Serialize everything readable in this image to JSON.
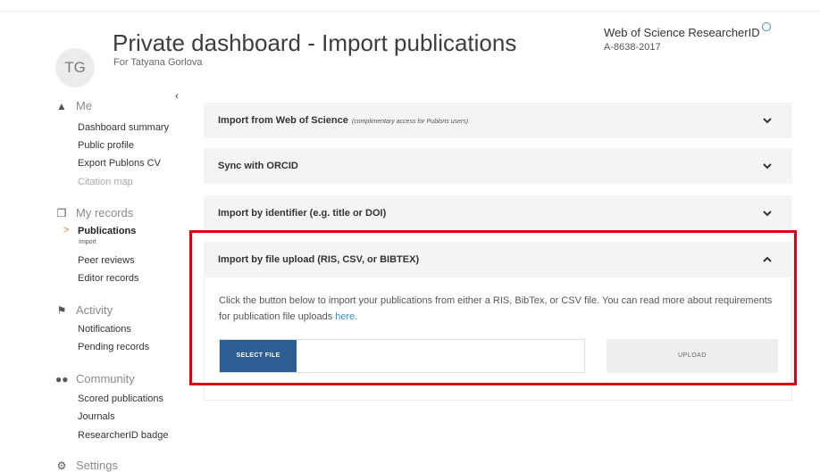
{
  "header": {
    "avatar_initials": "TG",
    "title": "Private dashboard - Import publications",
    "subtitle": "For Tatyana Gorlova",
    "researcher_id_label": "Web of Science ResearcherID",
    "researcher_id_value": "A-8638-2017"
  },
  "sidebar": {
    "collapse_glyph": "‹",
    "sections": {
      "me": {
        "label": "Me",
        "icon": "person-icon"
      },
      "records": {
        "label": "My records",
        "icon": "records-icon"
      },
      "activity": {
        "label": "Activity",
        "icon": "flag-icon"
      },
      "community": {
        "label": "Community",
        "icon": "group-icon"
      },
      "settings": {
        "label": "Settings",
        "icon": "gear-icon"
      }
    },
    "me_items": [
      "Dashboard summary",
      "Public profile",
      "Export Publons CV",
      "Citation map"
    ],
    "records_items": [
      "Publications",
      "Import",
      "Peer reviews",
      "Editor records"
    ],
    "activity_items": [
      "Notifications",
      "Pending records"
    ],
    "community_items": [
      "Scored publications",
      "Journals",
      "ResearcherID badge"
    ]
  },
  "panels": {
    "wos_label": "Import from Web of Science",
    "wos_note": "(complimentary access for Publons users)",
    "orcid_label": "Sync with ORCID",
    "identifier_label": "Import by identifier (e.g. title or DOI)",
    "file_label": "Import by file upload (RIS, CSV, or BIBTEX)",
    "file_body_text": "Click the button below to import your publications from either a RIS, BibTex, or CSV file. You can read more about requirements for publication file uploads",
    "file_body_link": "here",
    "file_body_end": ".",
    "select_file_label": "SELECT FILE",
    "upload_label": "UPLOAD"
  },
  "colors": {
    "highlight": "#e00012",
    "primary_button": "#2d5f95",
    "link": "#3b8bd1",
    "active_marker": "#f07c20"
  }
}
